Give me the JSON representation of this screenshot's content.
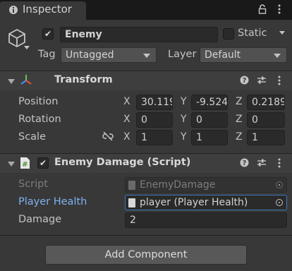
{
  "tab": {
    "title": "Inspector",
    "info_icon": "info-icon",
    "lock_icon": "lock-icon",
    "menu_icon": "kebab-menu-icon"
  },
  "gameobject": {
    "active": true,
    "name": "Enemy",
    "static_label": "Static",
    "static_checked": false,
    "tag_label": "Tag",
    "tag_value": "Untagged",
    "layer_label": "Layer",
    "layer_value": "Default"
  },
  "transform": {
    "title": "Transform",
    "rows": [
      {
        "label": "Position",
        "x": "30.119",
        "y": "-9.524",
        "z": "0.2189"
      },
      {
        "label": "Rotation",
        "x": "0",
        "y": "0",
        "z": "0"
      },
      {
        "label": "Scale",
        "x": "1",
        "y": "1",
        "z": "1"
      }
    ],
    "axes": [
      "X",
      "Y",
      "Z"
    ]
  },
  "script_component": {
    "title": "Enemy Damage (Script)",
    "enabled": true,
    "script_label": "Script",
    "script_value": "EnemyDamage",
    "player_health_label": "Player Health",
    "player_health_value": "player (Player Health)",
    "damage_label": "Damage",
    "damage_value": "2"
  },
  "add_component_label": "Add Component",
  "colors": {
    "background": "#383838",
    "field": "#2a2a2a",
    "highlight_label": "#7fb2f0",
    "selected_border": "#3a79bb"
  }
}
